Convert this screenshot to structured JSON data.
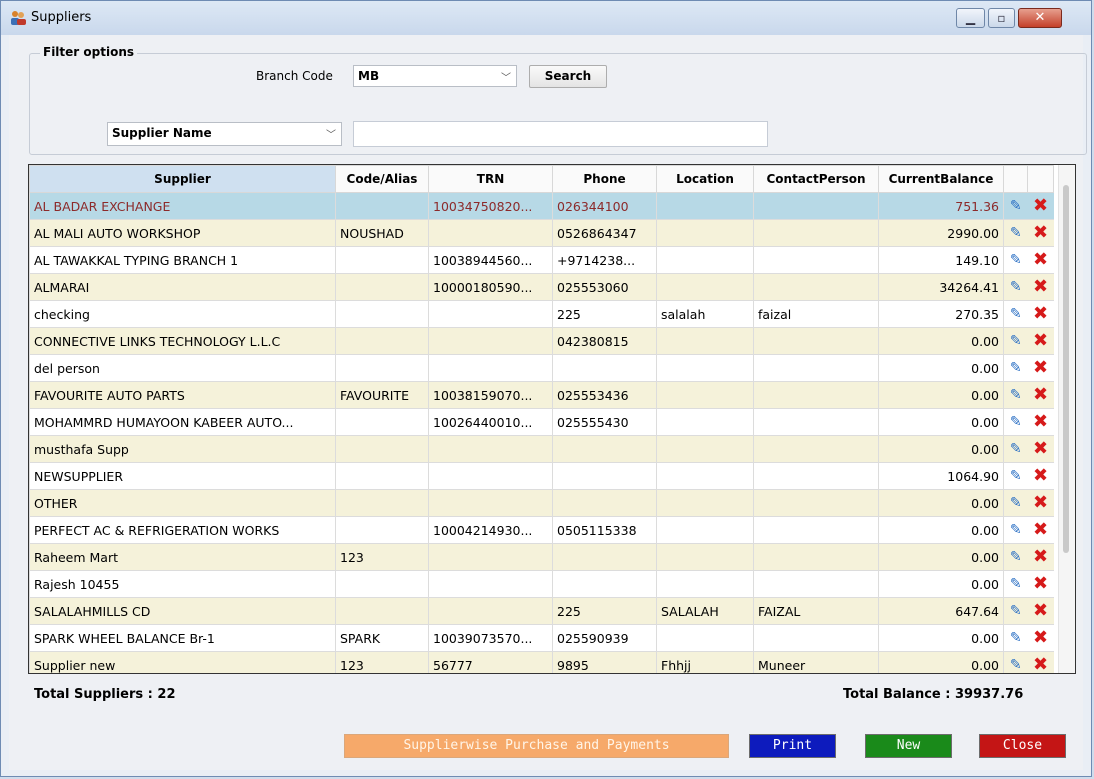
{
  "window": {
    "title": "Suppliers",
    "app_icon": "users-icon"
  },
  "filter": {
    "group_title": "Filter options",
    "branch_label": "Branch Code",
    "branch_value": "MB",
    "search_label": "Search",
    "name_field_value": "Supplier Name",
    "name_input_value": ""
  },
  "grid": {
    "headers": [
      "Supplier",
      "Code/Alias",
      "TRN",
      "Phone",
      "Location",
      "ContactPerson",
      "CurrentBalance"
    ],
    "rows": [
      [
        "AL BADAR EXCHANGE",
        "",
        "10034750820...",
        "026344100",
        "",
        "",
        "751.36"
      ],
      [
        "AL MALI AUTO WORKSHOP",
        "NOUSHAD",
        "",
        "0526864347",
        "",
        "",
        "2990.00"
      ],
      [
        "AL TAWAKKAL TYPING BRANCH 1",
        "",
        "10038944560...",
        "+9714238...",
        "",
        "",
        "149.10"
      ],
      [
        "ALMARAI",
        "",
        "10000180590...",
        "025553060",
        "",
        "",
        "34264.41"
      ],
      [
        "checking",
        "",
        "",
        "225",
        "salalah",
        "faizal",
        "270.35"
      ],
      [
        "CONNECTIVE LINKS TECHNOLOGY L.L.C",
        "",
        "",
        "042380815",
        "",
        "",
        "0.00"
      ],
      [
        "del person",
        "",
        "",
        "",
        "",
        "",
        "0.00"
      ],
      [
        "FAVOURITE AUTO PARTS",
        "FAVOURITE",
        "10038159070...",
        "025553436",
        "",
        "",
        "0.00"
      ],
      [
        "MOHAMMRD HUMAYOON KABEER AUTO...",
        "",
        "10026440010...",
        "025555430",
        "",
        "",
        "0.00"
      ],
      [
        "musthafa Supp",
        "",
        "",
        "",
        "",
        "",
        "0.00"
      ],
      [
        "NEWSUPPLIER",
        "",
        "",
        "",
        "",
        "",
        "1064.90"
      ],
      [
        "OTHER",
        "",
        "",
        "",
        "",
        "",
        "0.00"
      ],
      [
        "PERFECT AC & REFRIGERATION WORKS",
        "",
        "10004214930...",
        "0505115338",
        "",
        "",
        "0.00"
      ],
      [
        "Raheem Mart",
        "123",
        "",
        "",
        "",
        "",
        "0.00"
      ],
      [
        "Rajesh 10455",
        "",
        "",
        "",
        "",
        "",
        "0.00"
      ],
      [
        "SALALAHMILLS CD",
        "",
        "",
        "225",
        "SALALAH",
        "FAIZAL",
        "647.64"
      ],
      [
        "SPARK WHEEL BALANCE Br-1",
        "SPARK",
        "10039073570...",
        "025590939",
        "",
        "",
        "0.00"
      ],
      [
        "Supplier new",
        "123",
        "56777",
        "9895",
        "Fhhjj",
        "Muneer",
        "0.00"
      ]
    ]
  },
  "footer": {
    "total_suppliers": "Total Suppliers : 22",
    "total_balance": "Total Balance : 39937.76"
  },
  "buttons": {
    "supplierwise": "Supplierwise Purchase and Payments",
    "print": "Print",
    "new": "New",
    "close": "Close"
  }
}
